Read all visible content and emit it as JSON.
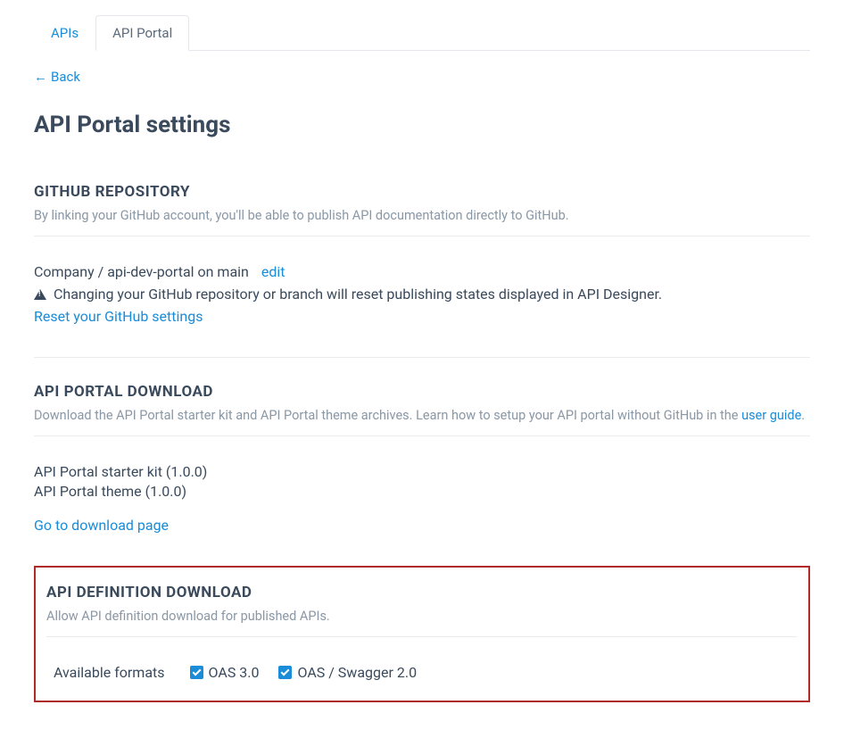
{
  "tabs": {
    "apis": "APIs",
    "api_portal": "API Portal"
  },
  "back": "Back",
  "page_title": "API Portal settings",
  "github_section": {
    "header": "GITHUB REPOSITORY",
    "desc": "By linking your GitHub account, you'll be able to publish API documentation directly to GitHub.",
    "repo_text": "Company / api-dev-portal on main",
    "edit": "edit",
    "warning": "Changing your GitHub repository or branch will reset publishing states displayed in API Designer.",
    "reset_link": "Reset your GitHub settings"
  },
  "download_section": {
    "header": "API PORTAL DOWNLOAD",
    "desc_prefix": "Download the API Portal starter kit and API Portal theme archives. Learn how to setup your API portal without GitHub in the ",
    "desc_link": "user guide",
    "desc_suffix": ".",
    "items": [
      "API Portal starter kit (1.0.0)",
      "API Portal theme (1.0.0)"
    ],
    "go_link": "Go to download page"
  },
  "definition_section": {
    "header": "API DEFINITION DOWNLOAD",
    "desc": "Allow API definition download for published APIs.",
    "formats_label": "Available formats",
    "oas3": "OAS 3.0",
    "swagger2": "OAS / Swagger 2.0"
  }
}
